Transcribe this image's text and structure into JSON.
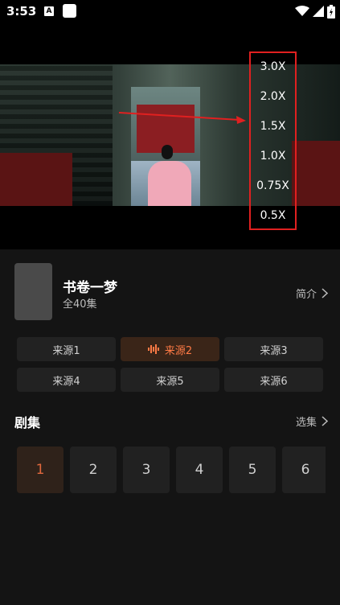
{
  "status": {
    "time": "3:53",
    "a_badge": "A"
  },
  "player": {
    "speeds": [
      "3.0X",
      "2.0X",
      "1.5X",
      "1.0X",
      "0.75X",
      "0.5X"
    ]
  },
  "show": {
    "title": "书卷一梦",
    "episodes_total": "全40集",
    "intro_label": "简介"
  },
  "sources": [
    "来源1",
    "来源2",
    "来源3",
    "来源4",
    "来源5",
    "来源6"
  ],
  "active_source_index": 1,
  "episodes_section": {
    "title": "剧集",
    "select_label": "选集",
    "items": [
      "1",
      "2",
      "3",
      "4",
      "5",
      "6"
    ],
    "active_index": 0
  },
  "colors": {
    "accent": "#ff7a45",
    "annotation_red": "#e02020",
    "background": "#141414"
  },
  "icons": [
    "wifi-icon",
    "signal-icon",
    "battery-icon",
    "audio-wave-icon",
    "chevron-right-icon"
  ]
}
